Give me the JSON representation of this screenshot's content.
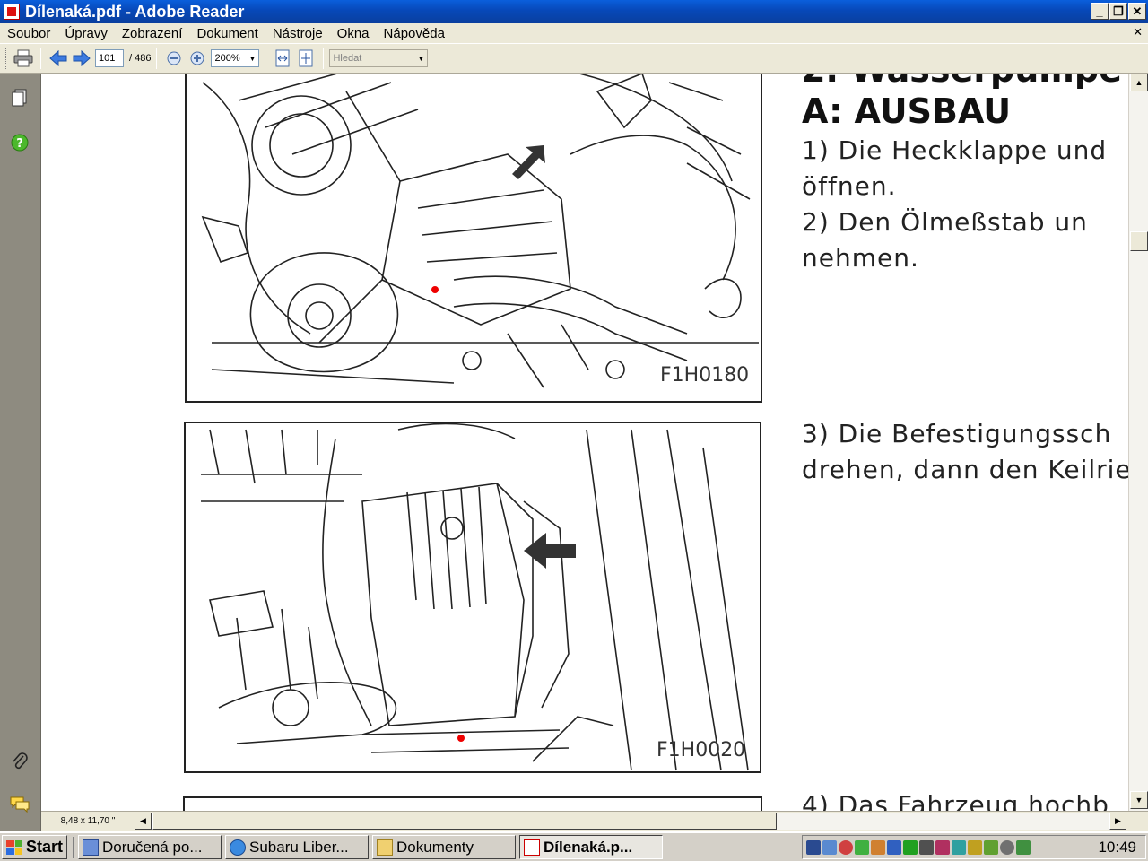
{
  "window": {
    "title": "Dílenaká.pdf - Adobe Reader"
  },
  "menu": [
    "Soubor",
    "Úpravy",
    "Zobrazení",
    "Dokument",
    "Nástroje",
    "Okna",
    "Nápověda"
  ],
  "toolbar": {
    "page_current": "101",
    "page_total": "/ 486",
    "zoom": "200%",
    "search_placeholder": "Hledat"
  },
  "document": {
    "heading_partial": "2. Wasserpumpe",
    "heading": "A: AUSBAU",
    "lines_top": [
      "1) Die Heckklappe und",
      "öffnen.",
      "2) Den Ölmeßstab un",
      "nehmen."
    ],
    "lines_mid": [
      "3) Die Befestigungssch",
      "drehen, dann den Keilrie"
    ],
    "lines_bottom": [
      "4) Das Fahrzeug hochb"
    ],
    "figure1_label": "F1H0180",
    "figure2_label": "F1H0020"
  },
  "status": {
    "page_size": "8,48 x 11,70 \""
  },
  "taskbar": {
    "start": "Start",
    "tasks": [
      "Doručená po...",
      "Subaru Liber...",
      "Dokumenty",
      "Dílenaká.p..."
    ],
    "clock": "10:49"
  },
  "icons": {
    "print": "printer-icon",
    "prev": "arrow-left-icon",
    "next": "arrow-right-icon",
    "zoom_out": "zoom-out-icon",
    "zoom_in": "zoom-in-icon",
    "fit_width": "fit-width-icon",
    "fit_page": "fit-page-icon",
    "pages": "pages-icon",
    "help": "help-icon",
    "attachments": "paperclip-icon",
    "comments": "comments-icon"
  },
  "colors": {
    "titlebar": "#0748b8",
    "nav_pane": "#8e8b80",
    "annotation_dot": "#ee0000"
  }
}
